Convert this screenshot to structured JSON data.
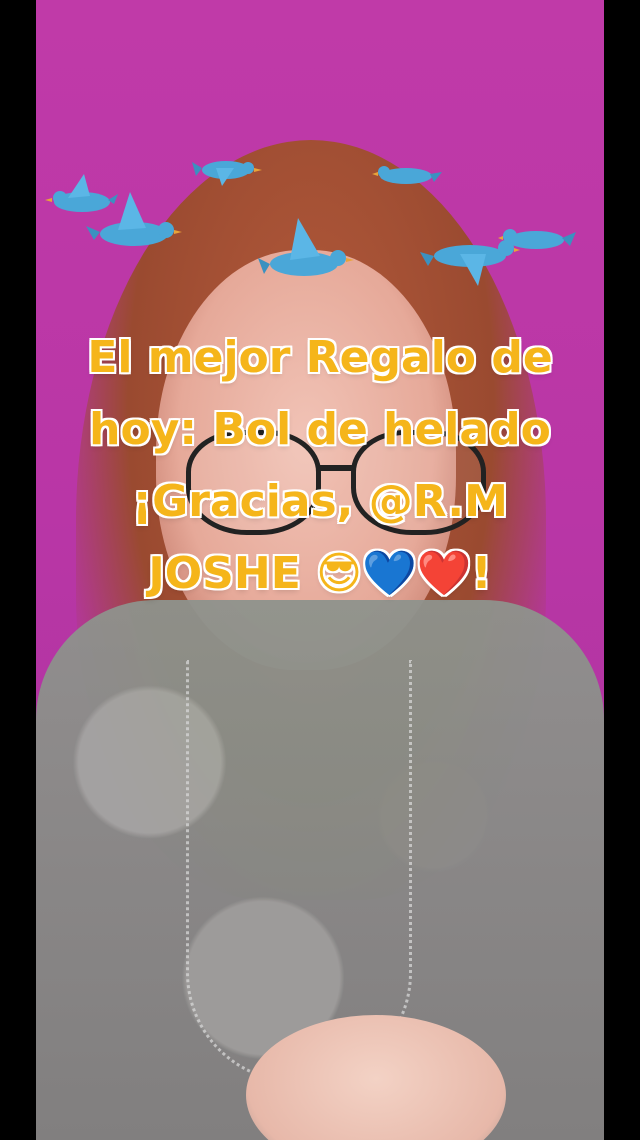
{
  "overlay": {
    "line1": "El mejor Regalo de",
    "line2": "hoy: Bol de helado",
    "line3": "¡Gracias, @R.M",
    "line4": "JOSHE 😎💙❤️!"
  },
  "filter": {
    "name": "bird-crown-filter",
    "bird_color": "#4aa7d8",
    "bird_count": 7
  },
  "colors": {
    "background_magenta": "#c03aa8",
    "text_accent": "#f5b51a",
    "text_outline": "#ffffff"
  }
}
